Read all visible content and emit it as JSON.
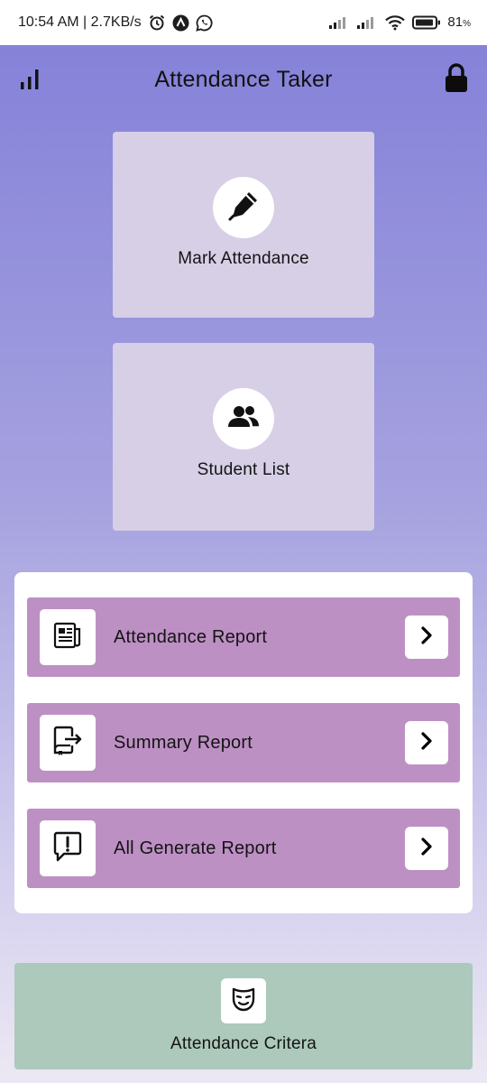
{
  "status_bar": {
    "time_speed": "10:54 AM | 2.7KB/s",
    "battery": "81",
    "battery_unit": "%",
    "icons": [
      "alarm-icon",
      "app-notification-icon",
      "whatsapp-icon",
      "signal-icon",
      "signal-icon",
      "wifi-icon",
      "battery-icon"
    ]
  },
  "header": {
    "title": "Attendance Taker",
    "left_icon": "bar-chart-icon",
    "right_icon": "lock-icon"
  },
  "tiles": [
    {
      "label": "Mark Attendance",
      "icon": "pen-icon"
    },
    {
      "label": "Student List",
      "icon": "users-icon"
    }
  ],
  "reports": [
    {
      "label": "Attendance Report",
      "icon": "newspaper-icon"
    },
    {
      "label": "Summary Report",
      "icon": "export-document-icon"
    },
    {
      "label": "All Generate Report",
      "icon": "alert-message-icon"
    }
  ],
  "criteria": {
    "label": "Attendance Critera",
    "icon": "mask-icon"
  },
  "colors": {
    "gradient_top": "#8582d9",
    "tile_bg": "#d6cfe6",
    "report_row_bg": "#bd90c4",
    "criteria_bg": "#acc9bb"
  }
}
